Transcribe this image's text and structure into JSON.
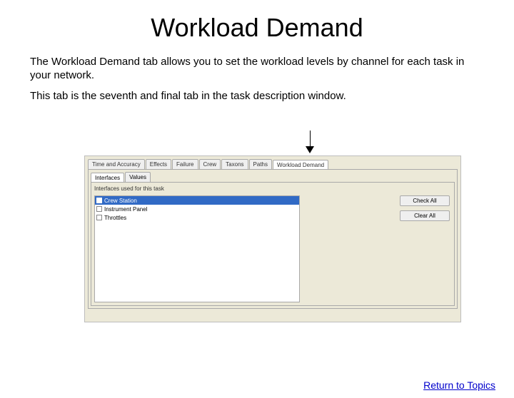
{
  "title": "Workload Demand",
  "paragraph1": "The Workload Demand tab allows you to set the workload levels by channel for each task in your network.",
  "paragraph2": "This tab is the seventh and final tab in the task description window.",
  "window": {
    "tabs": [
      "Time and Accuracy",
      "Effects",
      "Failure",
      "Crew",
      "Taxons",
      "Paths",
      "Workload Demand"
    ],
    "subtabs": [
      "Interfaces",
      "Values"
    ],
    "list_label": "Interfaces used for this task",
    "items": [
      "Crew Station",
      "Instrument Panel",
      "Throttles"
    ],
    "btn_check_all": "Check All",
    "btn_clear_all": "Clear All"
  },
  "return_link": "Return to Topics"
}
